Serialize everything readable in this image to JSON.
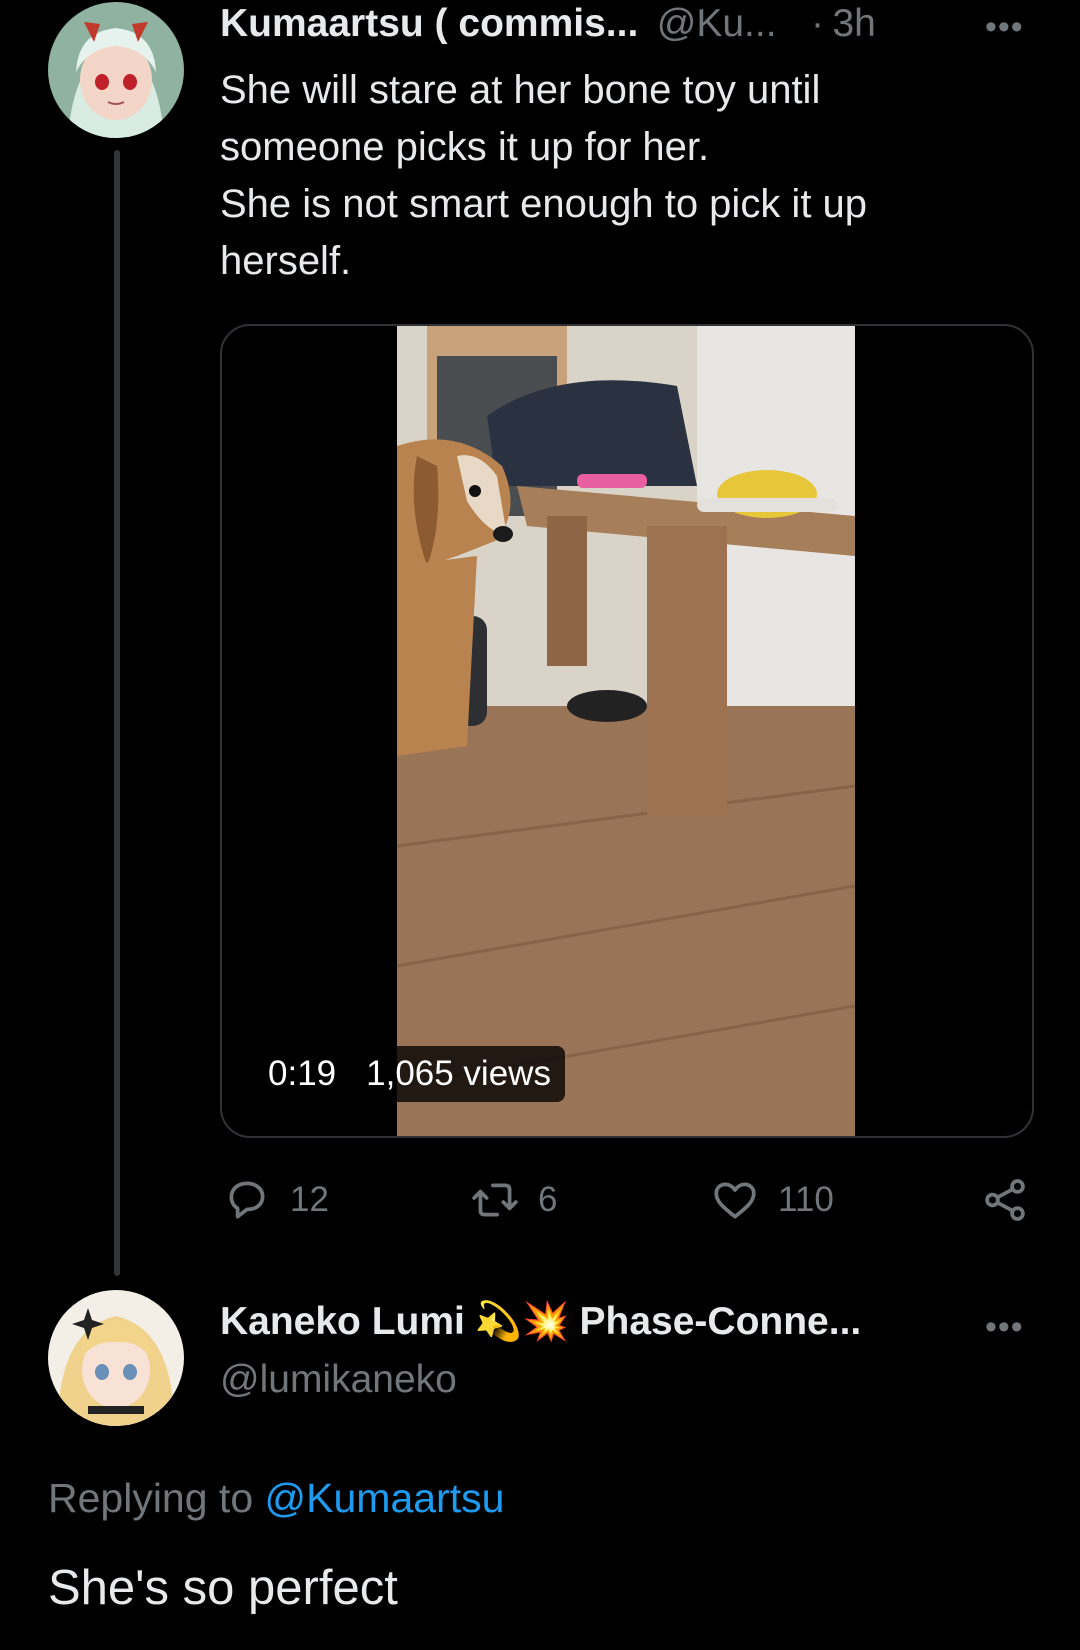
{
  "tweet": {
    "author_name": "Kumaartsu ( commis...",
    "author_handle": "@Ku...",
    "separator": "·",
    "time": "3h",
    "more_icon": "more-horizontal-icon",
    "text_lines": [
      "She will stare at her bone toy until",
      "someone picks it up for her.",
      "She is not smart enough to pick it up",
      "herself."
    ],
    "media": {
      "type": "video",
      "duration": "0:19",
      "views": "1,065 views"
    },
    "actions": {
      "reply_count": "12",
      "retweet_count": "6",
      "like_count": "110",
      "icons": [
        "reply-icon",
        "retweet-icon",
        "like-icon",
        "share-icon"
      ]
    }
  },
  "reply": {
    "author_name": "Kaneko Lumi",
    "emojis": "💫💥",
    "author_name_suffix": "Phase-Conne...",
    "author_handle": "@lumikaneko",
    "replying_prefix": "Replying to",
    "replying_to": "@Kumaartsu",
    "text": "She's so perfect"
  },
  "colors": {
    "background": "#000000",
    "primary_text": "#e7e9ea",
    "secondary_text": "#71767b",
    "link": "#1d9bf0",
    "border": "#2f3336"
  }
}
